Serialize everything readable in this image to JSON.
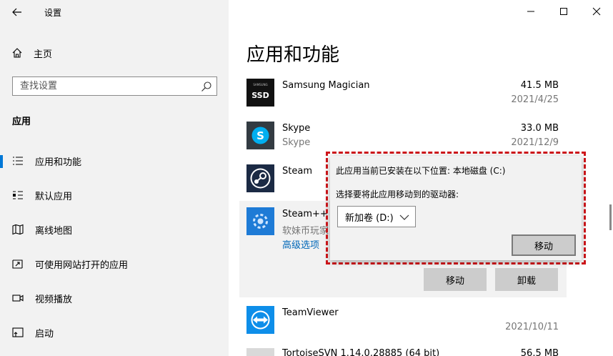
{
  "window": {
    "title": "设置"
  },
  "sidebar": {
    "home_label": "主页",
    "search_placeholder": "查找设置",
    "section": "应用",
    "items": [
      {
        "label": "应用和功能",
        "icon": "list-icon",
        "active": true
      },
      {
        "label": "默认应用",
        "icon": "default-apps-icon"
      },
      {
        "label": "离线地图",
        "icon": "map-icon"
      },
      {
        "label": "可使用网站打开的应用",
        "icon": "open-website-icon"
      },
      {
        "label": "视频播放",
        "icon": "video-icon"
      },
      {
        "label": "启动",
        "icon": "startup-icon"
      }
    ]
  },
  "main": {
    "title": "应用和功能",
    "apps": [
      {
        "name": "Samsung Magician",
        "size": "41.5 MB",
        "date": "2021/4/25",
        "icon": "ssd-icon"
      },
      {
        "name": "Skype",
        "sub": "Skype",
        "size": "33.0 MB",
        "date": "2021/12/9",
        "icon": "skype-icon"
      },
      {
        "name": "Steam",
        "icon": "steam-icon"
      },
      {
        "name": "Steam++",
        "sub": "软妹币玩家",
        "link": "高级选项",
        "icon": "steampp-icon"
      },
      {
        "name": "TeamViewer",
        "date": "2021/10/11",
        "icon": "teamviewer-icon"
      },
      {
        "name": "TortoiseSVN 1.14.0.28885 (64 bit)",
        "size": "56.5 MB"
      }
    ],
    "move_label": "移动",
    "uninstall_label": "卸载"
  },
  "popup": {
    "line1": "此应用当前已安装在以下位置: 本地磁盘 (C:)",
    "line2": "选择要将此应用移动到的驱动器:",
    "drive_value": "新加卷 (D:)",
    "move_label": "移动"
  },
  "colors": {
    "accent": "#0078d7",
    "link": "#0067b8",
    "highlight": "#d0161b"
  }
}
